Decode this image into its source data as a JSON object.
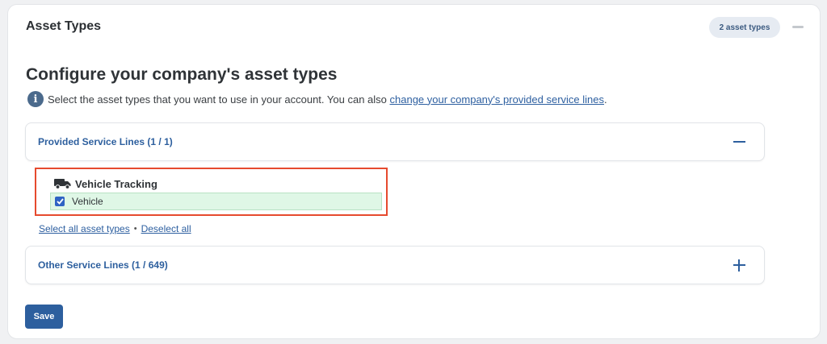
{
  "card": {
    "title": "Asset Types",
    "badge": "2 asset types"
  },
  "main": {
    "heading": "Configure your company's asset types",
    "description": "Select the asset types that you want to use in your account. You can also ",
    "description_link": "change your company's provided service lines",
    "description_end": "."
  },
  "provided_section": {
    "label": "Provided Service Lines (1 / 1)",
    "expanded": true,
    "group": {
      "title": "Vehicle Tracking",
      "icon": "truck-icon",
      "items": [
        {
          "label": "Vehicle",
          "checked": true
        }
      ]
    }
  },
  "links": {
    "select_all": "Select all asset types",
    "separator": "•",
    "deselect_all": "Deselect all"
  },
  "other_section": {
    "label": "Other Service Lines (1 / 649)",
    "expanded": false
  },
  "actions": {
    "save_label": "Save"
  },
  "colors": {
    "accent": "#2d5f9e",
    "highlight_border": "#e64a2e",
    "selected_row_bg": "#dff7e6",
    "badge_bg": "#e6ebf2"
  }
}
